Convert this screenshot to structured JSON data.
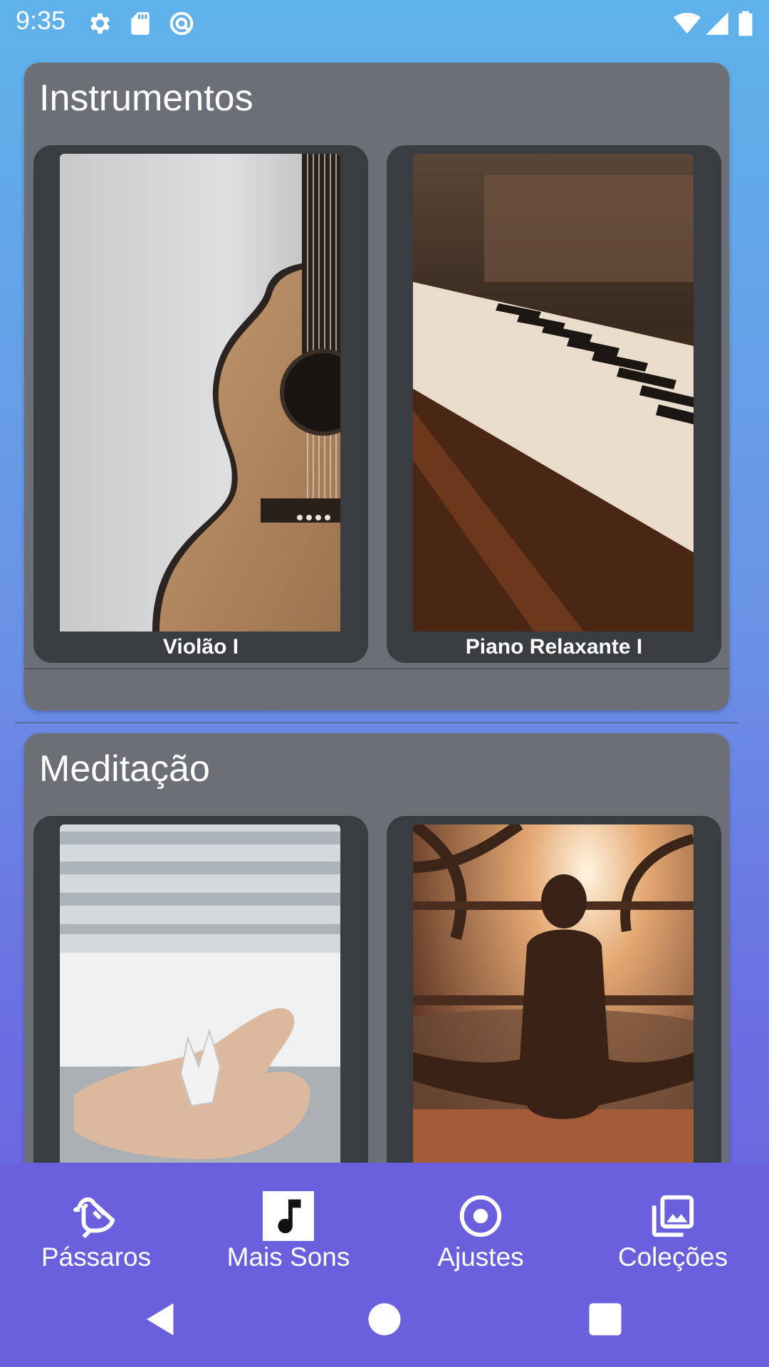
{
  "status_bar": {
    "time": "9:35",
    "left_icons": [
      "settings-icon",
      "sd-card-icon",
      "sync-icon"
    ],
    "right_icons": [
      "wifi-icon",
      "signal-icon",
      "battery-icon"
    ]
  },
  "sections": [
    {
      "title": "Instrumentos",
      "items": [
        {
          "label": "Violão I",
          "image": "acoustic-guitar-photo"
        },
        {
          "label": "Piano Relaxante I",
          "image": "piano-keys-photo"
        }
      ]
    },
    {
      "title": "Meditação",
      "items": [
        {
          "label": "",
          "image": "hand-holding-crystal-photo"
        },
        {
          "label": "",
          "image": "woman-meditating-sunset-photo"
        }
      ]
    }
  ],
  "bottom_nav": {
    "items": [
      {
        "label": "Pássaros",
        "icon": "bird-icon",
        "selected": false
      },
      {
        "label": "Mais Sons",
        "icon": "music-note-icon",
        "selected": true
      },
      {
        "label": "Ajustes",
        "icon": "radio-button-icon",
        "selected": false
      },
      {
        "label": "Coleções",
        "icon": "photo-library-icon",
        "selected": false
      }
    ]
  },
  "system_nav": [
    "back-icon",
    "home-icon",
    "recents-icon"
  ],
  "colors": {
    "card_bg": "#6c6f76",
    "item_bg": "#393c41",
    "nav_bg": "#6a5fdc",
    "gradient_top": "#5fb2ea",
    "gradient_bottom": "#6a5fdc"
  }
}
